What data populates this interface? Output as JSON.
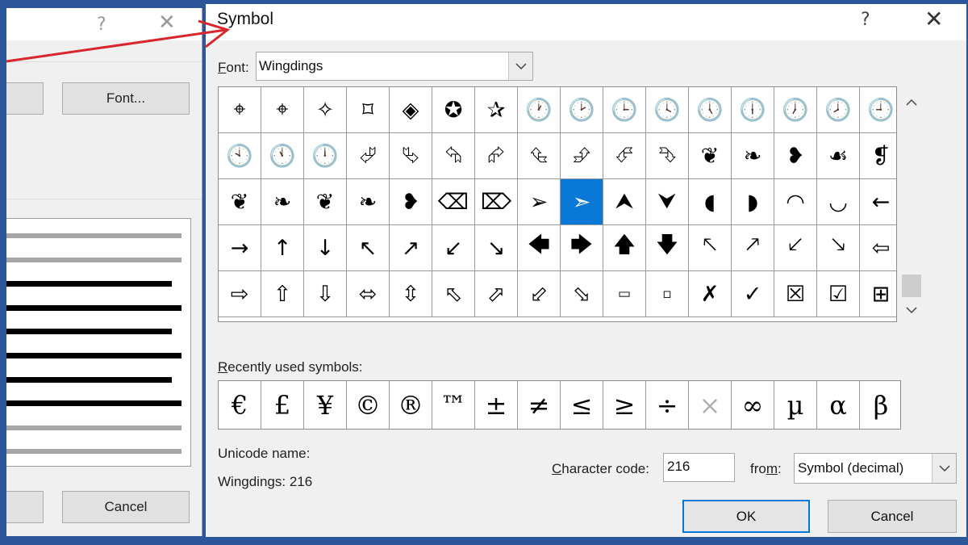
{
  "background_dialog": {
    "help_glyph": "?",
    "close_glyph": "✕",
    "left_button_label": "",
    "font_button_label": "Font...",
    "cancel_label": "Cancel"
  },
  "dialog": {
    "title": "Symbol",
    "help_glyph": "?",
    "close_glyph": "✕"
  },
  "font": {
    "label": "Font:",
    "value": "Wingdings"
  },
  "symbol_grid": {
    "rows": [
      [
        "⌖",
        "⌖",
        "✧",
        "⌑",
        "◈",
        "✪",
        "✰",
        "🕐",
        "🕑",
        "🕒",
        "🕓",
        "🕔",
        "🕕",
        "🕖",
        "🕗",
        "🕘"
      ],
      [
        "🕙",
        "🕚",
        "🕛",
        "⮰",
        "⮱",
        "⮲",
        "⮳",
        "⮴",
        "⮵",
        "⮶",
        "⮷",
        "❦",
        "❧",
        "❥",
        "☙",
        "❡"
      ],
      [
        "❦",
        "❧",
        "❦",
        "❧",
        "❥",
        "⌫",
        "⌦",
        "➢",
        "➣",
        "⮝",
        "⮟",
        "◖",
        "◗",
        "◠",
        "◡",
        "←"
      ],
      [
        "→",
        "↑",
        "↓",
        "↖",
        "↗",
        "↙",
        "↘",
        "🡄",
        "🡆",
        "🡅",
        "🡇",
        "🡔",
        "🡕",
        "🡗",
        "🡖",
        "⇦"
      ],
      [
        "⇨",
        "⇧",
        "⇩",
        "⬄",
        "⇳",
        "⬁",
        "⬀",
        "⬃",
        "⬂",
        "▭",
        "▫",
        "✗",
        "✓",
        "☒",
        "☑",
        "⊞"
      ]
    ],
    "selected_symbol": "➢"
  },
  "recent": {
    "label": "Recently used symbols:",
    "symbols": [
      "€",
      "£",
      "¥",
      "©",
      "®",
      "™",
      "±",
      "≠",
      "≤",
      "≥",
      "÷",
      "×",
      "∞",
      "µ",
      "α",
      "β"
    ]
  },
  "unicode": {
    "name_label": "Unicode name:",
    "name_value": "Wingdings: 216"
  },
  "character_code": {
    "label": "Character code:",
    "value": "216"
  },
  "from": {
    "label": "from:",
    "value": "Symbol (decimal)"
  },
  "buttons": {
    "ok": "OK",
    "cancel": "Cancel"
  },
  "colors": {
    "selection": "#0a78d7",
    "ok_border": "#0078d7",
    "annotation_arrow": "#d9262c",
    "desktop": "#2b579a"
  }
}
